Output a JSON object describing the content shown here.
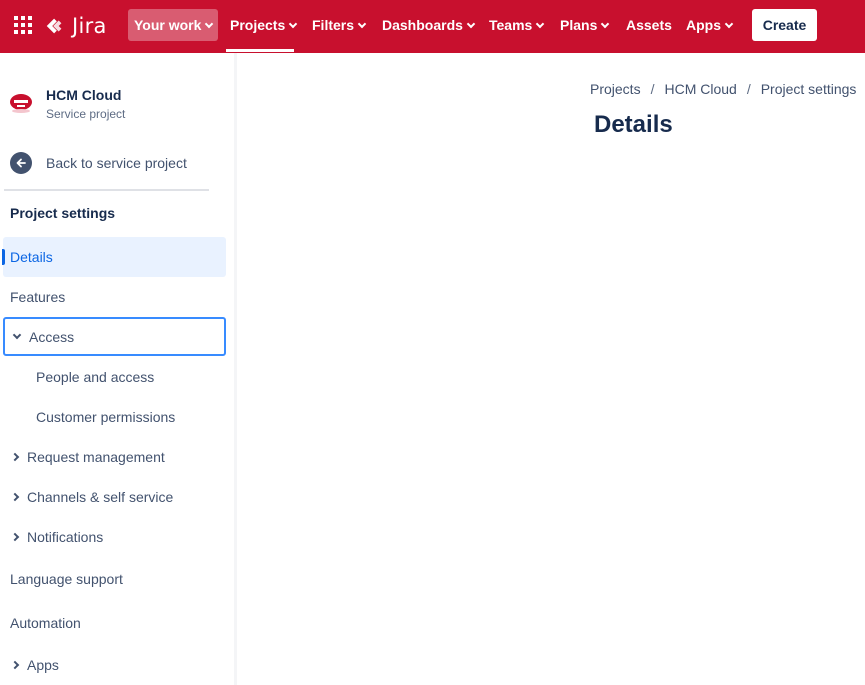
{
  "topnav": {
    "logo_text": "Jira",
    "items": [
      {
        "label": "Your work"
      },
      {
        "label": "Projects"
      },
      {
        "label": "Filters"
      },
      {
        "label": "Dashboards"
      },
      {
        "label": "Teams"
      },
      {
        "label": "Plans"
      },
      {
        "label": "Assets"
      },
      {
        "label": "Apps"
      }
    ],
    "create_label": "Create",
    "brand_color": "#c8102e"
  },
  "sidebar": {
    "project_name": "HCM Cloud",
    "project_type": "Service project",
    "back_label": "Back to service project",
    "section_title": "Project settings",
    "items": [
      {
        "label": "Details"
      },
      {
        "label": "Features"
      },
      {
        "label": "Access"
      },
      {
        "label": "People and access"
      },
      {
        "label": "Customer permissions"
      },
      {
        "label": "Request management"
      },
      {
        "label": "Channels & self service"
      },
      {
        "label": "Notifications"
      },
      {
        "label": "Language support"
      },
      {
        "label": "Automation"
      },
      {
        "label": "Apps"
      }
    ],
    "selected_color": "#0c66e4"
  },
  "main": {
    "breadcrumb": [
      "Projects",
      "HCM Cloud",
      "Project settings"
    ],
    "title": "Details"
  }
}
